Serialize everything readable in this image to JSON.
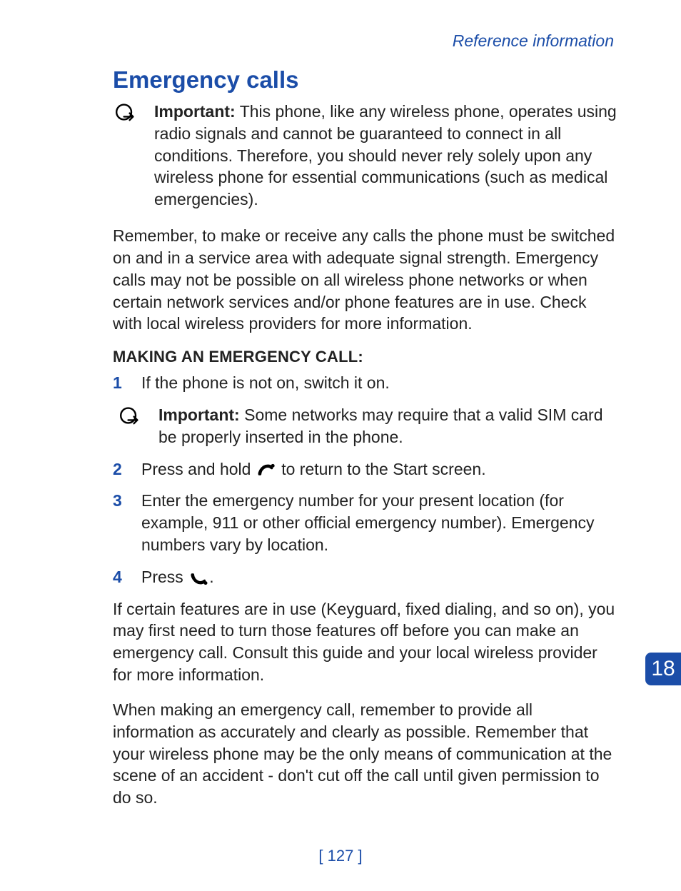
{
  "section_label": "Reference information",
  "heading": "Emergency calls",
  "important1": {
    "label": "Important:",
    "text": " This phone, like any wireless phone, operates using radio signals and cannot be guaranteed to connect in all conditions. Therefore, you should never rely solely upon any wireless phone for essential communications (such as medical emergencies)."
  },
  "para1": "Remember, to make or receive any calls the phone must be switched on and in a service area with adequate signal strength. Emergency calls may not be possible on all wireless phone networks or when certain network services and/or phone features are in use. Check with local wireless providers for more information.",
  "subhead": "MAKING AN EMERGENCY CALL:",
  "steps": {
    "n1": "1",
    "s1": "If the phone is not on, switch it on.",
    "n2": "2",
    "s2a": "Press and hold ",
    "s2b": " to return to the Start screen.",
    "n3": "3",
    "s3": "Enter the emergency number for your present location (for example, 911 or other official emergency number). Emergency numbers vary by location.",
    "n4": "4",
    "s4a": "Press ",
    "s4b": "."
  },
  "important2": {
    "label": "Important:",
    "text": " Some networks may require that a valid SIM card be properly inserted in the phone."
  },
  "para2": "If certain features are in use (Keyguard, fixed dialing, and so on), you may first need to turn those features off before you can make an emergency call. Consult this guide and your local wireless provider for more information.",
  "para3": "When making an emergency call, remember to provide all information as accurately and clearly as possible. Remember that your wireless phone may be the only means of communication at the scene of an accident - don't cut off the call until given permission to do so.",
  "chapter_number": "18",
  "page_number": "[ 127 ]"
}
